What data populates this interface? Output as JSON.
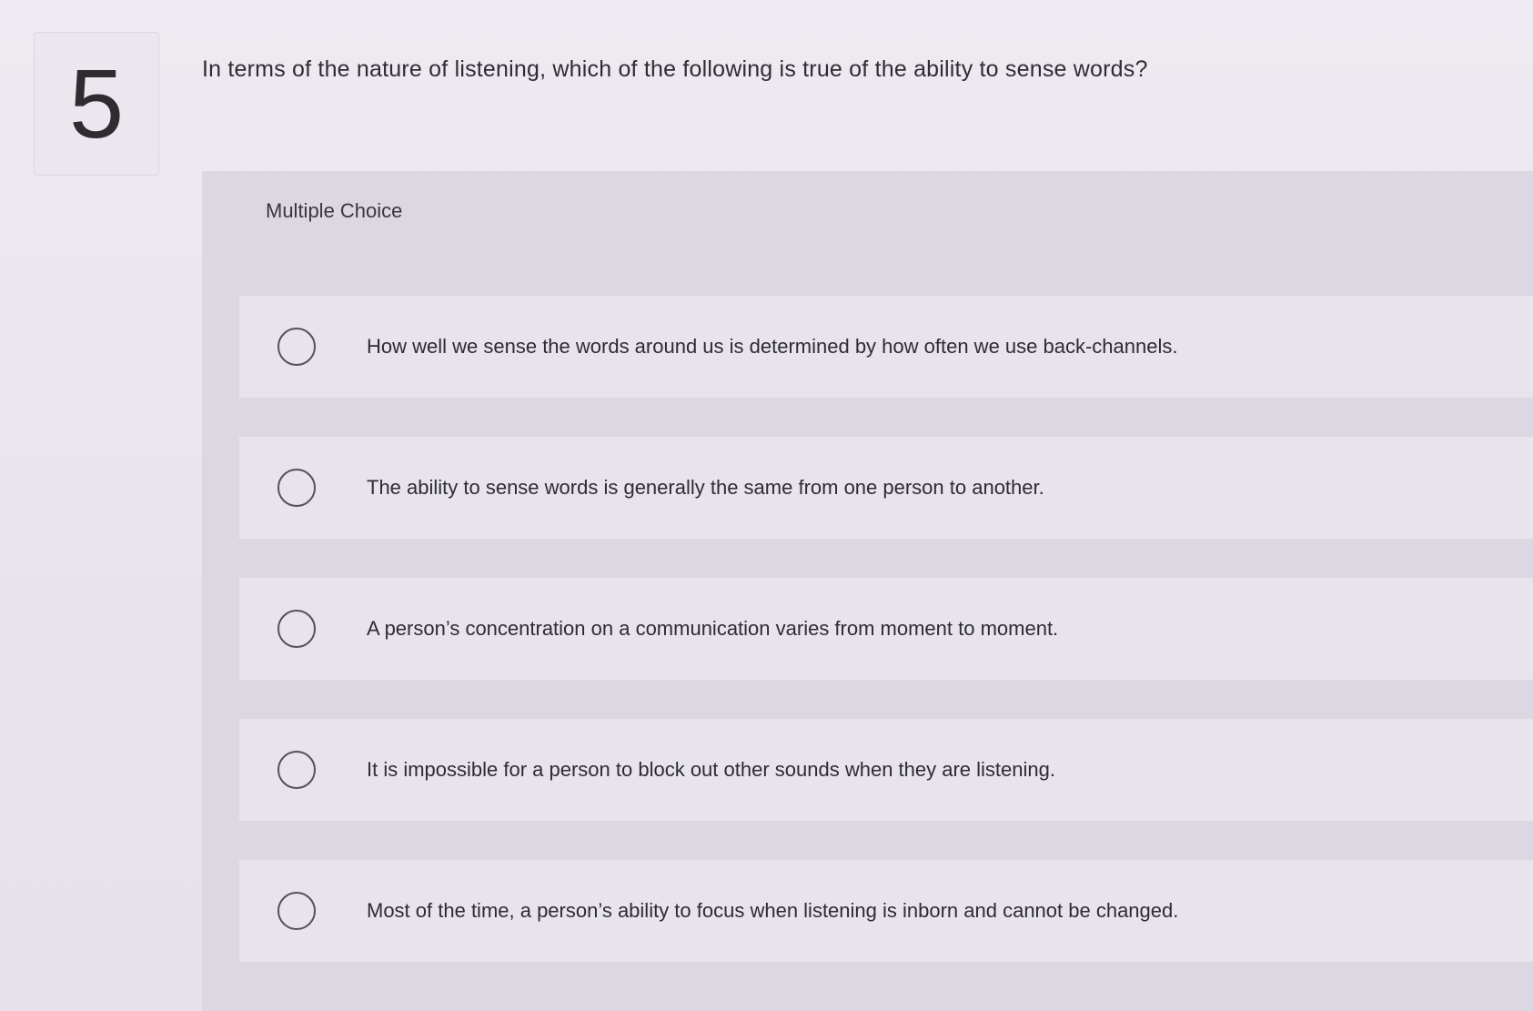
{
  "question": {
    "number": "5",
    "text": "In terms of the nature of listening, which of the following is true of the ability to sense words?"
  },
  "answer_type": "Multiple Choice",
  "choices": [
    {
      "label": "How well we sense the words around us is determined by how often we use back-channels."
    },
    {
      "label": "The ability to sense words is generally the same from one person to another."
    },
    {
      "label": "A person’s concentration on a communication varies from moment to moment."
    },
    {
      "label": "It is impossible for a person to block out other sounds when they are listening."
    },
    {
      "label": "Most of the time, a person’s ability to focus when listening is inborn and cannot be changed."
    }
  ]
}
